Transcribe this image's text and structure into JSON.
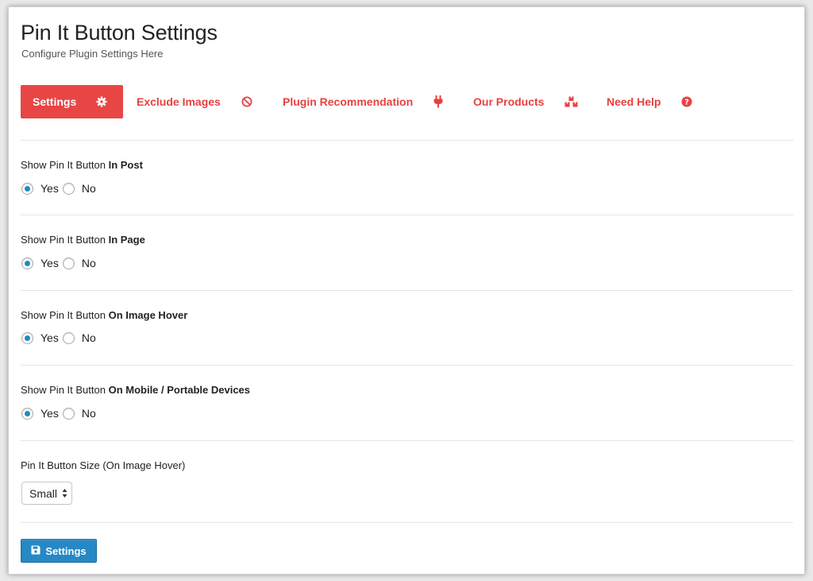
{
  "header": {
    "title": "Pin It Button Settings",
    "subtitle": "Configure Plugin Settings Here"
  },
  "tabs": [
    {
      "label": "Settings",
      "icon": "gear-icon",
      "active": true
    },
    {
      "label": "Exclude Images",
      "icon": "ban-icon",
      "active": false
    },
    {
      "label": "Plugin Recommendation",
      "icon": "plug-icon",
      "active": false
    },
    {
      "label": "Our Products",
      "icon": "cubes-icon",
      "active": false
    },
    {
      "label": "Need Help",
      "icon": "question-circle-icon",
      "active": false
    }
  ],
  "settings": [
    {
      "prefix": "Show Pin It Button ",
      "emphasis": "In Post",
      "options": [
        "Yes",
        "No"
      ],
      "selected": "Yes"
    },
    {
      "prefix": "Show Pin It Button ",
      "emphasis": "In Page",
      "options": [
        "Yes",
        "No"
      ],
      "selected": "Yes"
    },
    {
      "prefix": "Show Pin It Button ",
      "emphasis": "On Image Hover",
      "options": [
        "Yes",
        "No"
      ],
      "selected": "Yes"
    },
    {
      "prefix": "Show Pin It Button ",
      "emphasis": "On Mobile / Portable Devices",
      "options": [
        "Yes",
        "No"
      ],
      "selected": "Yes"
    }
  ],
  "size_setting": {
    "label": "Pin It Button Size (On Image Hover)",
    "value": "Small"
  },
  "save_button": {
    "label": "Settings",
    "icon": "floppy-disk-icon"
  },
  "colors": {
    "accent_red": "#e84545",
    "primary_blue": "#2688c4",
    "radio_selected": "#1e8cbe"
  }
}
